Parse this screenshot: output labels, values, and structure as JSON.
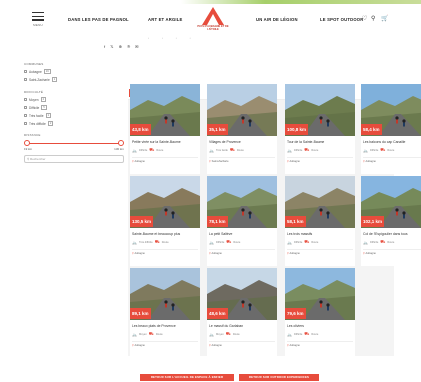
{
  "header": {
    "menu_label": "MENU",
    "nav": [
      "DANS LES PAS DE PAGNOL",
      "ART ET ARGILE",
      "UN AIR DE LÉGION",
      "LE SPOT OUTDOOR"
    ],
    "logo_text": "PAYS D'AUBAGNE ET DE L'ÉTOILE",
    "icons": [
      "heart-icon",
      "search-icon",
      "cart-icon"
    ]
  },
  "share_icons": [
    "facebook-icon",
    "x-icon",
    "share-icon",
    "pinterest-icon",
    "email-icon"
  ],
  "filters": {
    "communes_title": "COMMUNES",
    "communes": [
      {
        "label": "Aubagne",
        "count": "19"
      },
      {
        "label": "Saint-Zacharie",
        "count": "1"
      }
    ],
    "difficulty_title": "DIFFICULTÉ",
    "difficulty": [
      {
        "label": "Moyen",
        "count": "2"
      },
      {
        "label": "Difficile",
        "count": "5"
      },
      {
        "label": "Très facile",
        "count": "1"
      },
      {
        "label": "Très difficile",
        "count": "2"
      }
    ],
    "distance_title": "DISTANCE",
    "distance_min": "19 km",
    "distance_max": "130 km",
    "search_placeholder": "Rechercher"
  },
  "results": {
    "count": "11 résultats",
    "subtitle": "Le bon guide à toute pour préparer votre séjour",
    "list_label": "LISTE"
  },
  "cards": [
    {
      "distance": "43,8 km",
      "title": "Petite virée sur la Sainte-Baume",
      "difficulty": "Difficile",
      "activity": "Route",
      "location": "Aubagne"
    },
    {
      "distance": "35,1 km",
      "title": "Villages de Provence",
      "difficulty": "Très facile",
      "activity": "Route",
      "location": "Saint-Zacharie"
    },
    {
      "distance": "100,8 km",
      "title": "Tour de la Sainte-Baume",
      "difficulty": "Difficile",
      "activity": "Route",
      "location": "Aubagne"
    },
    {
      "distance": "58,4 km",
      "title": "Les balcons du cap Canaille",
      "difficulty": "Difficile",
      "activity": "Route",
      "location": "Aubagne"
    },
    {
      "distance": "130,5 km",
      "title": "Sainte-Baume et beaucoup plus",
      "difficulty": "Très difficile",
      "activity": "Route",
      "location": "Aubagne"
    },
    {
      "distance": "78,1 km",
      "title": "La petit Saltève",
      "difficulty": "Difficile",
      "activity": "Route",
      "location": "Aubagne"
    },
    {
      "distance": "58,1 km",
      "title": "Les trois massifs",
      "difficulty": "Difficile",
      "activity": "Route",
      "location": "Aubagne"
    },
    {
      "distance": "102,1 km",
      "title": "Col de l'Espigoulier dans tous",
      "difficulty": "Difficile",
      "activity": "Route",
      "location": "Aubagne"
    },
    {
      "distance": "89,1 km",
      "title": "Les beaux plats de Provence",
      "difficulty": "Moyen",
      "activity": "Route",
      "location": "Aubagne"
    },
    {
      "distance": "48,6 km",
      "title": "Le massif du Garlaban",
      "difficulty": "Moyen",
      "activity": "Route",
      "location": "Aubagne"
    },
    {
      "distance": "79,6 km",
      "title": "Les oliviers",
      "difficulty": "Difficile",
      "activity": "Route",
      "location": "Aubagne"
    }
  ],
  "bottom_buttons": [
    "RETOUR SUR L'ACCUEIL DE ESPACE À ENFIER",
    "RETOUR SUR OUTDOOR EXPERIENCES"
  ],
  "colors": {
    "accent": "#e74c3c",
    "green": "#a6cf6a"
  }
}
